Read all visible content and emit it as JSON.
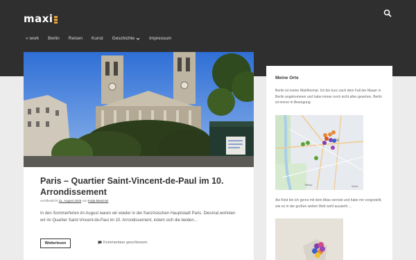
{
  "site": {
    "logo": "maxi"
  },
  "nav": {
    "items": [
      {
        "label": "« work"
      },
      {
        "label": "Berlin"
      },
      {
        "label": "Reisen"
      },
      {
        "label": "Kunst"
      },
      {
        "label": "Geschichte"
      },
      {
        "label": "Impressum"
      }
    ]
  },
  "post": {
    "title": "Paris – Quartier Saint-Vincent-de-Paul im 10. Arrondissement",
    "meta_prefix": "veröffentlicht",
    "date": "31. August 2025",
    "meta_by": "von",
    "author": "Katja Maximini",
    "excerpt": "In den Sommerferien im August waren wir wieder in der französischen Hauptstadt Paris. Diesmal wohnten wir im Quartier Saint-Vincent-de-Paul im 10. Arrondissement, indem sich die beiden…",
    "more_label": "Weiterlesen",
    "comments_label": "Kommentare geschlossen"
  },
  "sidebar": {
    "title": "Meine Orte",
    "text1": "Berlin ist meine Wahlheimat. Ich bin kurz nach dem Fall der Mauer in Berlin angekommen und habe immer noch nicht alles gesehen. Berlin ist immer in Bewegung.",
    "text2": "Als Kind bin ich gerne mit dem Atlas verreist und habe mir vorgestellt, wie es in der großen weiten Welt wohl aussieht …",
    "map1_labels": {
      "city": "lin",
      "south": "Teltow",
      "east": "Schö"
    }
  },
  "colors": {
    "header_bg": "#2f2f2f",
    "accent": "#e8a33d",
    "page_bg": "#ececec"
  }
}
